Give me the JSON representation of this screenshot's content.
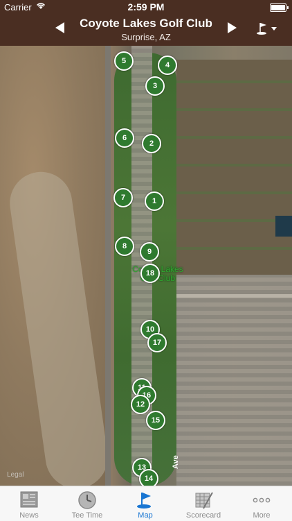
{
  "status": {
    "carrier": "Carrier",
    "time": "2:59 PM",
    "battery_level": 1.0
  },
  "header": {
    "title": "Coyote Lakes Golf Club",
    "subtitle": "Surprise, AZ",
    "prev_icon": "left-arrow-icon",
    "next_icon": "right-arrow-icon",
    "flag_icon": "golf-flag-icon"
  },
  "map": {
    "course_label_line1": "Coyote Lakes",
    "course_label_line2": "Golf Club",
    "legal_label": "Legal",
    "street_label": "Ave",
    "holes": [
      "5",
      "4",
      "3",
      "6",
      "2",
      "7",
      "1",
      "8",
      "9",
      "18",
      "10",
      "17",
      "11",
      "16",
      "12",
      "15",
      "13",
      "14"
    ]
  },
  "tabs": [
    {
      "label": "News",
      "icon": "newspaper-icon",
      "active": false
    },
    {
      "label": "Tee Time",
      "icon": "clock-icon",
      "active": false
    },
    {
      "label": "Map",
      "icon": "golf-flag-icon",
      "active": true
    },
    {
      "label": "Scorecard",
      "icon": "scorecard-icon",
      "active": false
    },
    {
      "label": "More",
      "icon": "more-dots-icon",
      "active": false
    }
  ],
  "colors": {
    "header_bg": "#4a2e22",
    "pin": "#2f7a2f",
    "active_tab": "#1976d2"
  }
}
